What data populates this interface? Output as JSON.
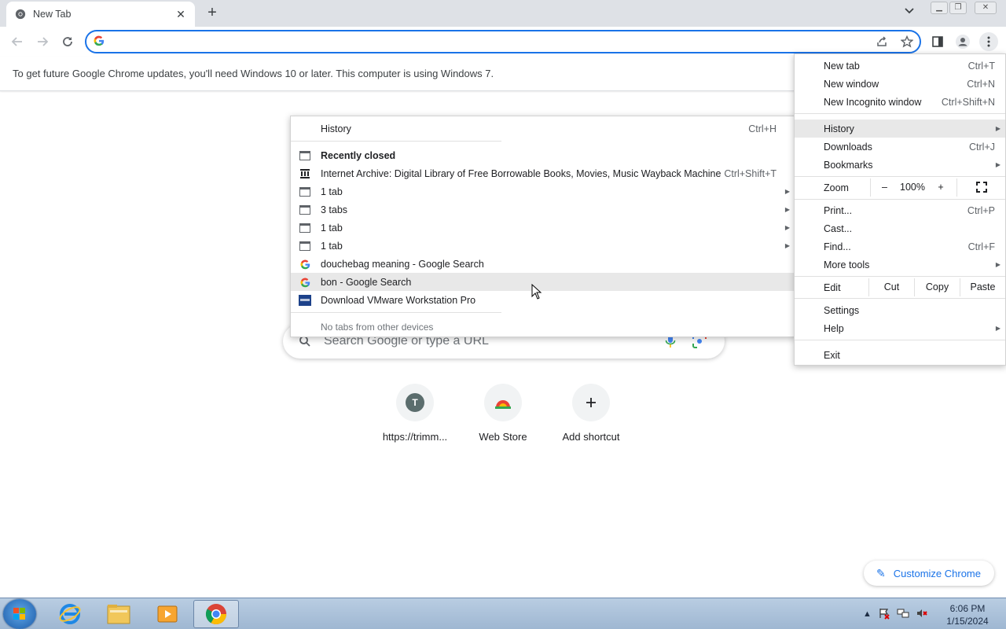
{
  "tab": {
    "title": "New Tab"
  },
  "omnibox": {
    "value": ""
  },
  "infobar": {
    "message": "To get future Google Chrome updates, you'll need Windows 10 or later. This computer is using Windows 7."
  },
  "ntp": {
    "search_placeholder": "Search Google or type a URL",
    "shortcuts": [
      {
        "label": "https://trimm...",
        "initial": "T"
      },
      {
        "label": "Web Store"
      },
      {
        "label": "Add shortcut"
      }
    ],
    "customize_label": "Customize Chrome"
  },
  "main_menu": {
    "new_tab": {
      "label": "New tab",
      "shortcut": "Ctrl+T"
    },
    "new_window": {
      "label": "New window",
      "shortcut": "Ctrl+N"
    },
    "new_incognito": {
      "label": "New Incognito window",
      "shortcut": "Ctrl+Shift+N"
    },
    "history": {
      "label": "History"
    },
    "downloads": {
      "label": "Downloads",
      "shortcut": "Ctrl+J"
    },
    "bookmarks": {
      "label": "Bookmarks"
    },
    "zoom": {
      "label": "Zoom",
      "minus": "–",
      "value": "100%",
      "plus": "+"
    },
    "print": {
      "label": "Print...",
      "shortcut": "Ctrl+P"
    },
    "cast": {
      "label": "Cast..."
    },
    "find": {
      "label": "Find...",
      "shortcut": "Ctrl+F"
    },
    "more_tools": {
      "label": "More tools"
    },
    "edit": {
      "label": "Edit",
      "cut": "Cut",
      "copy": "Copy",
      "paste": "Paste"
    },
    "settings": {
      "label": "Settings"
    },
    "help": {
      "label": "Help"
    },
    "exit": {
      "label": "Exit"
    }
  },
  "history_menu": {
    "history": {
      "label": "History",
      "shortcut": "Ctrl+H"
    },
    "recently_closed": "Recently closed",
    "items": [
      {
        "label": "Internet Archive: Digital Library of Free  Borrowable Books, Movies, Music  Wayback Machine",
        "shortcut": "Ctrl+Shift+T",
        "icon": "archive-icon"
      },
      {
        "label": "1 tab",
        "icon": "window-icon"
      },
      {
        "label": "3 tabs",
        "icon": "window-icon"
      },
      {
        "label": "1 tab",
        "icon": "window-icon"
      },
      {
        "label": "1 tab",
        "icon": "window-icon"
      },
      {
        "label": "douchebag meaning - Google Search",
        "icon": "google-icon"
      },
      {
        "label": "bon - Google Search",
        "icon": "google-icon"
      },
      {
        "label": "Download VMware Workstation Pro",
        "icon": "vmware-icon"
      }
    ],
    "other_devices": "No tabs from other devices"
  },
  "taskbar": {
    "time": "6:06 PM",
    "date": "1/15/2024"
  },
  "colors": {
    "accent": "#1a73e8",
    "tabstrip": "#dee1e6",
    "menu_highlight": "#e8e8e8"
  }
}
